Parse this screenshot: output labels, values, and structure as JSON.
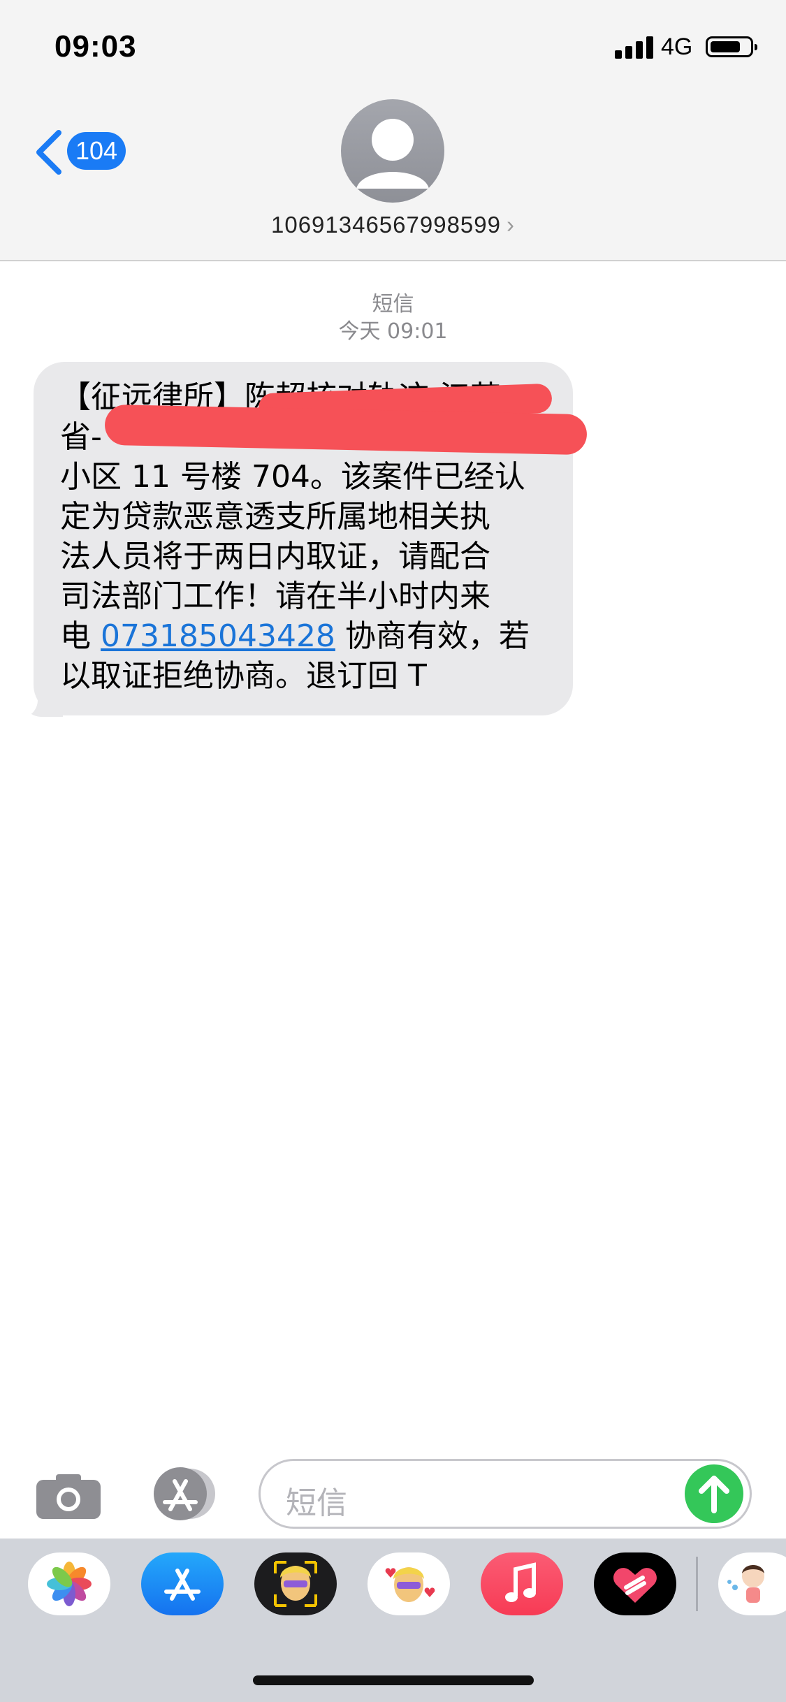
{
  "status_bar": {
    "time": "09:03",
    "network": "4G"
  },
  "header": {
    "back_badge": "104",
    "contact_number": "10691346567998599",
    "contact_chevron": "›"
  },
  "conversation": {
    "service_label": "短信",
    "timestamp": "今天 09:01",
    "message": {
      "line1": "【征远律所】陈超核对轨迹:江苏",
      "line2": "省-",
      "line3": "小区 11 号楼 704。该案件已经认",
      "line4": "定为贷款恶意透支所属地相关执",
      "line5": "法人员将于两日内取证，请配合",
      "line6": "司法部门工作！请在半小时内来",
      "line7_prefix": "电 ",
      "phone_link": "073185043428",
      "line7_suffix": " 协商有效，若",
      "line8": "以取证拒绝协商。退订回 T"
    }
  },
  "compose": {
    "placeholder": "短信"
  },
  "colors": {
    "accent": "#1a7bf5",
    "send": "#34c759",
    "bubble": "#e9e9eb",
    "redaction": "#f65157"
  },
  "icons": [
    "camera-icon",
    "app-store-icon",
    "send-arrow-icon",
    "photos-icon",
    "memoji-icon",
    "music-icon",
    "heart-app-icon",
    "sticker-icon"
  ]
}
